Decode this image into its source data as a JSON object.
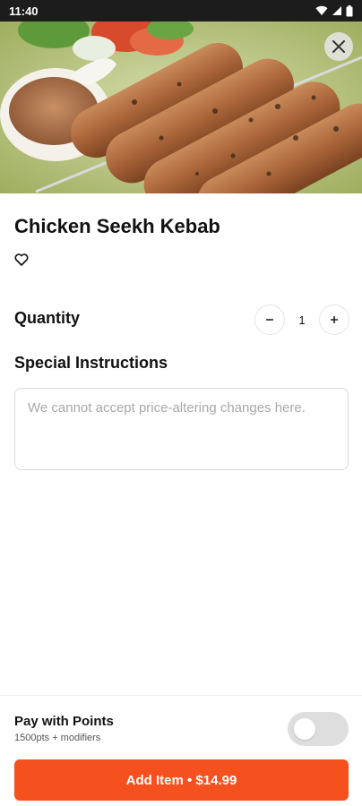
{
  "status_bar": {
    "time": "11:40"
  },
  "item": {
    "name": "Chicken Seekh Kebab"
  },
  "quantity": {
    "label": "Quantity",
    "value": "1"
  },
  "instructions": {
    "label": "Special Instructions",
    "placeholder": "We cannot accept price-altering changes here."
  },
  "points": {
    "title": "Pay with Points",
    "subtitle": "1500pts + modifiers",
    "enabled": false
  },
  "add_button": {
    "label": "Add Item • $14.99"
  },
  "colors": {
    "accent": "#f4511e",
    "toggle_off": "#dedede"
  }
}
